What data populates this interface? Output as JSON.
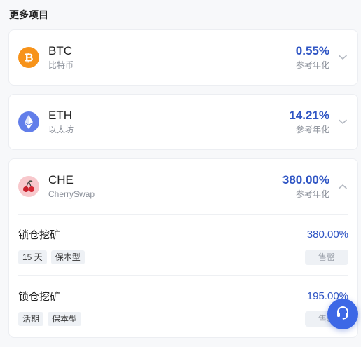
{
  "section": {
    "title": "更多项目"
  },
  "projects": [
    {
      "symbol": "BTC",
      "name": "比特币",
      "apr": "0.55%",
      "apr_label": "参考年化",
      "icon": "btc-icon",
      "icon_color": "#f7931a",
      "expanded": false
    },
    {
      "symbol": "ETH",
      "name": "以太坊",
      "apr": "14.21%",
      "apr_label": "参考年化",
      "icon": "eth-icon",
      "icon_color": "#627eea",
      "expanded": false
    },
    {
      "symbol": "CHE",
      "name": "CherrySwap",
      "apr": "380.00%",
      "apr_label": "参考年化",
      "icon": "cherry-icon",
      "icon_color": "#f8c8cc",
      "expanded": true,
      "items": [
        {
          "name": "锁仓挖矿",
          "rate": "380.00%",
          "tags": [
            "15 天",
            "保本型"
          ],
          "button": "售罄"
        },
        {
          "name": "锁仓挖矿",
          "rate": "195.00%",
          "tags": [
            "活期",
            "保本型"
          ],
          "button": "售罄"
        }
      ]
    }
  ],
  "support": {
    "icon": "headset-icon",
    "color": "#3d68e6"
  }
}
